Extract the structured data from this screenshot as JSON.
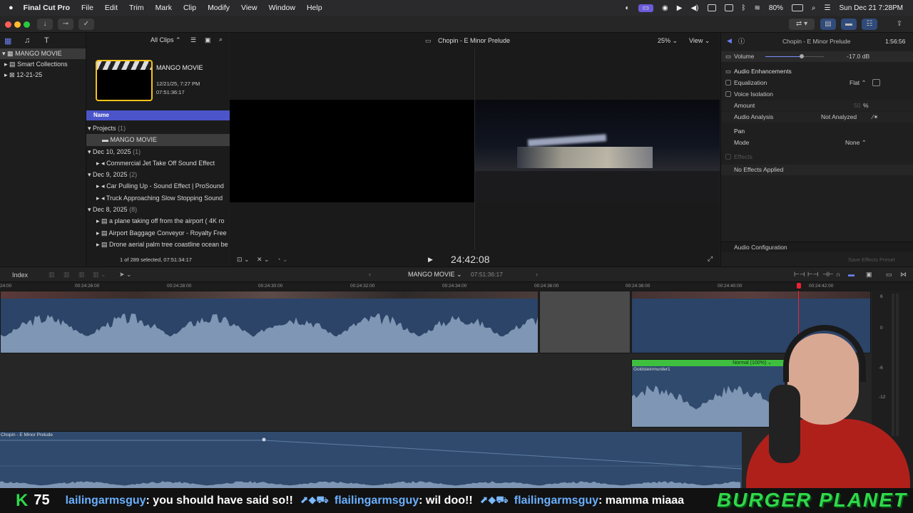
{
  "menubar": {
    "app_name": "Final Cut Pro",
    "items": [
      "File",
      "Edit",
      "Trim",
      "Mark",
      "Clip",
      "Modify",
      "View",
      "Window",
      "Help"
    ],
    "battery": "80%",
    "datetime": "Sun Dec 21  7:28PM"
  },
  "browser": {
    "filter": "All Clips",
    "library": {
      "name": "MANGO MOVIE",
      "items": [
        "Smart Collections",
        "12-21-25"
      ]
    },
    "event_card": {
      "title": "MANGO MOVIE",
      "date": "12/21/25, 7:27 PM",
      "duration": "07:51:36:17"
    },
    "column_header": "Name",
    "groups": [
      {
        "label": "Projects",
        "count": "(1)",
        "items": [
          {
            "name": "MANGO MOVIE",
            "kind": "project"
          }
        ]
      },
      {
        "label": "Dec 10, 2025",
        "count": "(1)",
        "items": [
          {
            "name": "Commercial Jet Take Off Sound Effect",
            "kind": "audio"
          }
        ]
      },
      {
        "label": "Dec 9, 2025",
        "count": "(2)",
        "items": [
          {
            "name": "Car Pulling Up - Sound Effect  |  ProSound",
            "kind": "audio"
          },
          {
            "name": "Truck Approaching Slow Stopping Sound",
            "kind": "audio"
          }
        ]
      },
      {
        "label": "Dec 8, 2025",
        "count": "(8)",
        "items": [
          {
            "name": "a plane taking off from the airport ( 4K ro",
            "kind": "video"
          },
          {
            "name": "Airport Baggage Conveyor - Royalty Free",
            "kind": "video"
          },
          {
            "name": "Drone aerial palm tree coastline ocean be",
            "kind": "video"
          }
        ]
      }
    ],
    "status": "1 of 289 selected, 07:51:34:17"
  },
  "viewer": {
    "title": "Chopin - E Minor Prelude",
    "zoom": "25%",
    "view_label": "View",
    "timecode": "24:42:08"
  },
  "inspector": {
    "title": "Chopin - E Minor Prelude",
    "duration": "1:56:56",
    "volume_label": "Volume",
    "volume_value": "-17.0  dB",
    "volume_level": 0.62,
    "section_enhancements": "Audio Enhancements",
    "equalization_label": "Equalization",
    "equalization_value": "Flat",
    "voice_isolation_label": "Voice Isolation",
    "amount_label": "Amount",
    "amount_value": "50",
    "amount_unit": "%",
    "audio_analysis_label": "Audio Analysis",
    "audio_analysis_value": "Not Analyzed",
    "pan_label": "Pan",
    "mode_label": "Mode",
    "mode_value": "None",
    "effects_label": "Effects",
    "no_effects": "No Effects Applied",
    "audio_config": "Audio Configuration",
    "save_preset": "Save Effects Preset"
  },
  "timeline": {
    "index_label": "Index",
    "project_name": "MANGO MOVIE",
    "project_duration": "07:51:36:17",
    "ruler_ticks": [
      "24:00",
      "00:24:26:00",
      "00:24:28:00",
      "00:24:30:00",
      "00:24:32:00",
      "00:24:34:00",
      "00:24:36:00",
      "00:24:38:00",
      "00:24:40:00",
      "00:24:42:00"
    ],
    "clip_blend_label": "Normal (100%)",
    "clip_name_connected": "Goldsteinmurder1",
    "music_clip_name": "Chopin - E Minor Prelude",
    "meter_labels": [
      "6",
      "0",
      "-6",
      "-12"
    ]
  },
  "ticker": {
    "count_letter": "K",
    "count": "75",
    "messages": [
      {
        "user": "lailingarmsguy",
        "text": ": you should have said so!!"
      },
      {
        "user": "flailingarmsguy",
        "text": ": wil doo!!"
      },
      {
        "user": "flailingarmsguy",
        "text": ": mamma miaaa"
      }
    ],
    "brand": "BURGER PLANET"
  },
  "colors": {
    "accent_blue": "#4b55c9",
    "audio_blue": "#2f4a6d",
    "waveform": "#7f96b4",
    "green_bar": "#3fbf3f",
    "ticker_user": "#6ab0ff",
    "brand_green": "#2fd84a"
  }
}
